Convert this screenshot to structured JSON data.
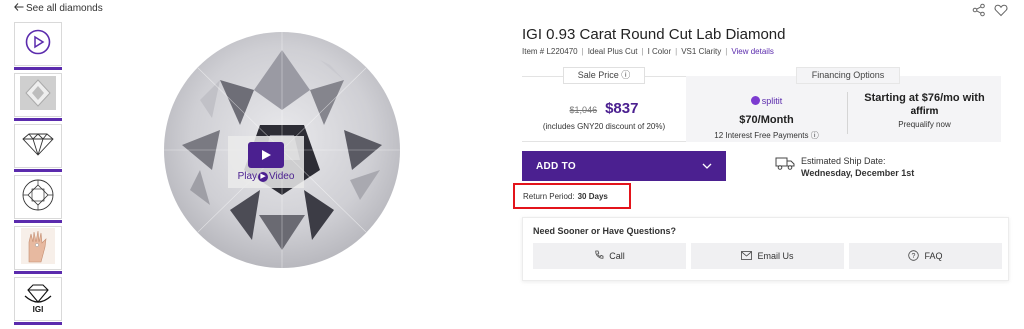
{
  "nav": {
    "back_label": "See all diamonds"
  },
  "thumbnails": [
    {
      "name": "video"
    },
    {
      "name": "photo"
    },
    {
      "name": "side-profile"
    },
    {
      "name": "top-view"
    },
    {
      "name": "hand-scale"
    },
    {
      "name": "igi-certificate",
      "logo_text": "IGI"
    }
  ],
  "media": {
    "play_label_prefix": "Play",
    "play_label_suffix": "Video"
  },
  "product": {
    "title": "IGI 0.93 Carat Round Cut Lab Diamond",
    "item": "Item # L220470",
    "cut": "Ideal Plus Cut",
    "color": "I Color",
    "clarity": "VS1 Clarity",
    "details_link": "View details"
  },
  "pricing": {
    "sale_tab": "Sale Price",
    "financing_tab": "Financing Options",
    "old_price": "$1,046",
    "new_price": "$837",
    "discount": "(includes GNY20 discount of 20%)"
  },
  "financing": {
    "splitit_logo": "splitit",
    "splitit_amount": "$70/Month",
    "splitit_sub": "12 Interest Free Payments",
    "affirm_main": "Starting at $76/mo with",
    "affirm_logo": "affirm",
    "affirm_sub": "Prequalify now"
  },
  "actions": {
    "add_to": "ADD TO"
  },
  "shipping": {
    "label": "Estimated Ship Date:",
    "date": "Wednesday, December 1st"
  },
  "returns": {
    "label": "Return Period:",
    "value": "30 Days"
  },
  "help": {
    "title": "Need Sooner or Have Questions?",
    "call": "Call",
    "email": "Email Us",
    "faq": "FAQ"
  },
  "colors": {
    "brand": "#4b2090",
    "highlight": "#e3141b"
  }
}
